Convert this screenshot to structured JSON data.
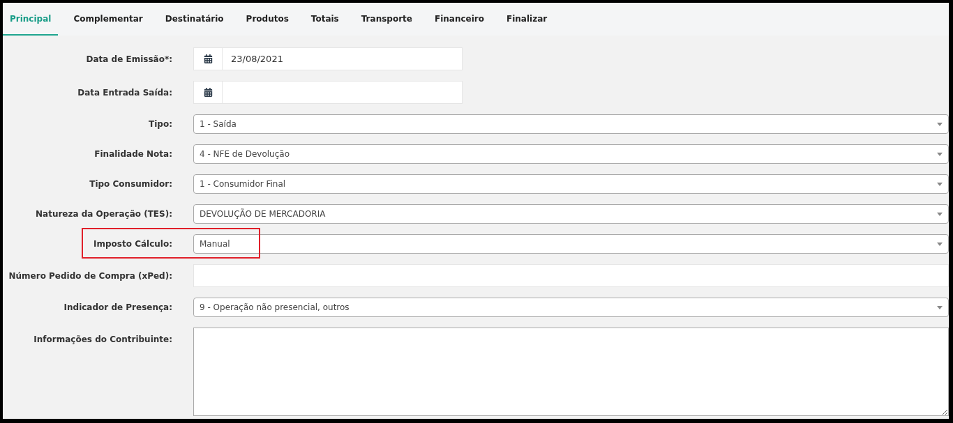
{
  "tabs": [
    {
      "label": "Principal",
      "selected": true
    },
    {
      "label": "Complementar",
      "selected": false
    },
    {
      "label": "Destinatário",
      "selected": false
    },
    {
      "label": "Produtos",
      "selected": false
    },
    {
      "label": "Totais",
      "selected": false
    },
    {
      "label": "Transporte",
      "selected": false
    },
    {
      "label": "Financeiro",
      "selected": false
    },
    {
      "label": "Finalizar",
      "selected": false
    }
  ],
  "fields": [
    {
      "kind": "date",
      "label": "Data de Emissão*:",
      "value": "23/08/2021",
      "highlighted": false
    },
    {
      "kind": "date",
      "label": "Data Entrada Saída:",
      "highlighted": false
    },
    {
      "kind": "select",
      "label": "Tipo:",
      "value": "1 - Saída",
      "highlighted": false
    },
    {
      "kind": "select",
      "label": "Finalidade Nota:",
      "value": "4 - NFE de Devolução",
      "highlighted": false
    },
    {
      "kind": "select",
      "label": "Tipo Consumidor:",
      "value": "1 - Consumidor Final",
      "highlighted": false
    },
    {
      "kind": "select",
      "label": "Natureza da Operação (TES):",
      "value": "DEVOLUÇÃO DE MERCADORIA",
      "highlighted": false
    },
    {
      "kind": "select",
      "label": "Imposto Cálculo:",
      "value": "Manual",
      "highlighted": true
    },
    {
      "kind": "text",
      "label": "Número Pedido de Compra (xPed):",
      "highlighted": false
    },
    {
      "kind": "select",
      "label": "Indicador de Presença:",
      "value": "9 - Operação não presencial, outros",
      "highlighted": false
    },
    {
      "kind": "textarea",
      "label": "Informações do Contribuinte:",
      "highlighted": false
    }
  ]
}
